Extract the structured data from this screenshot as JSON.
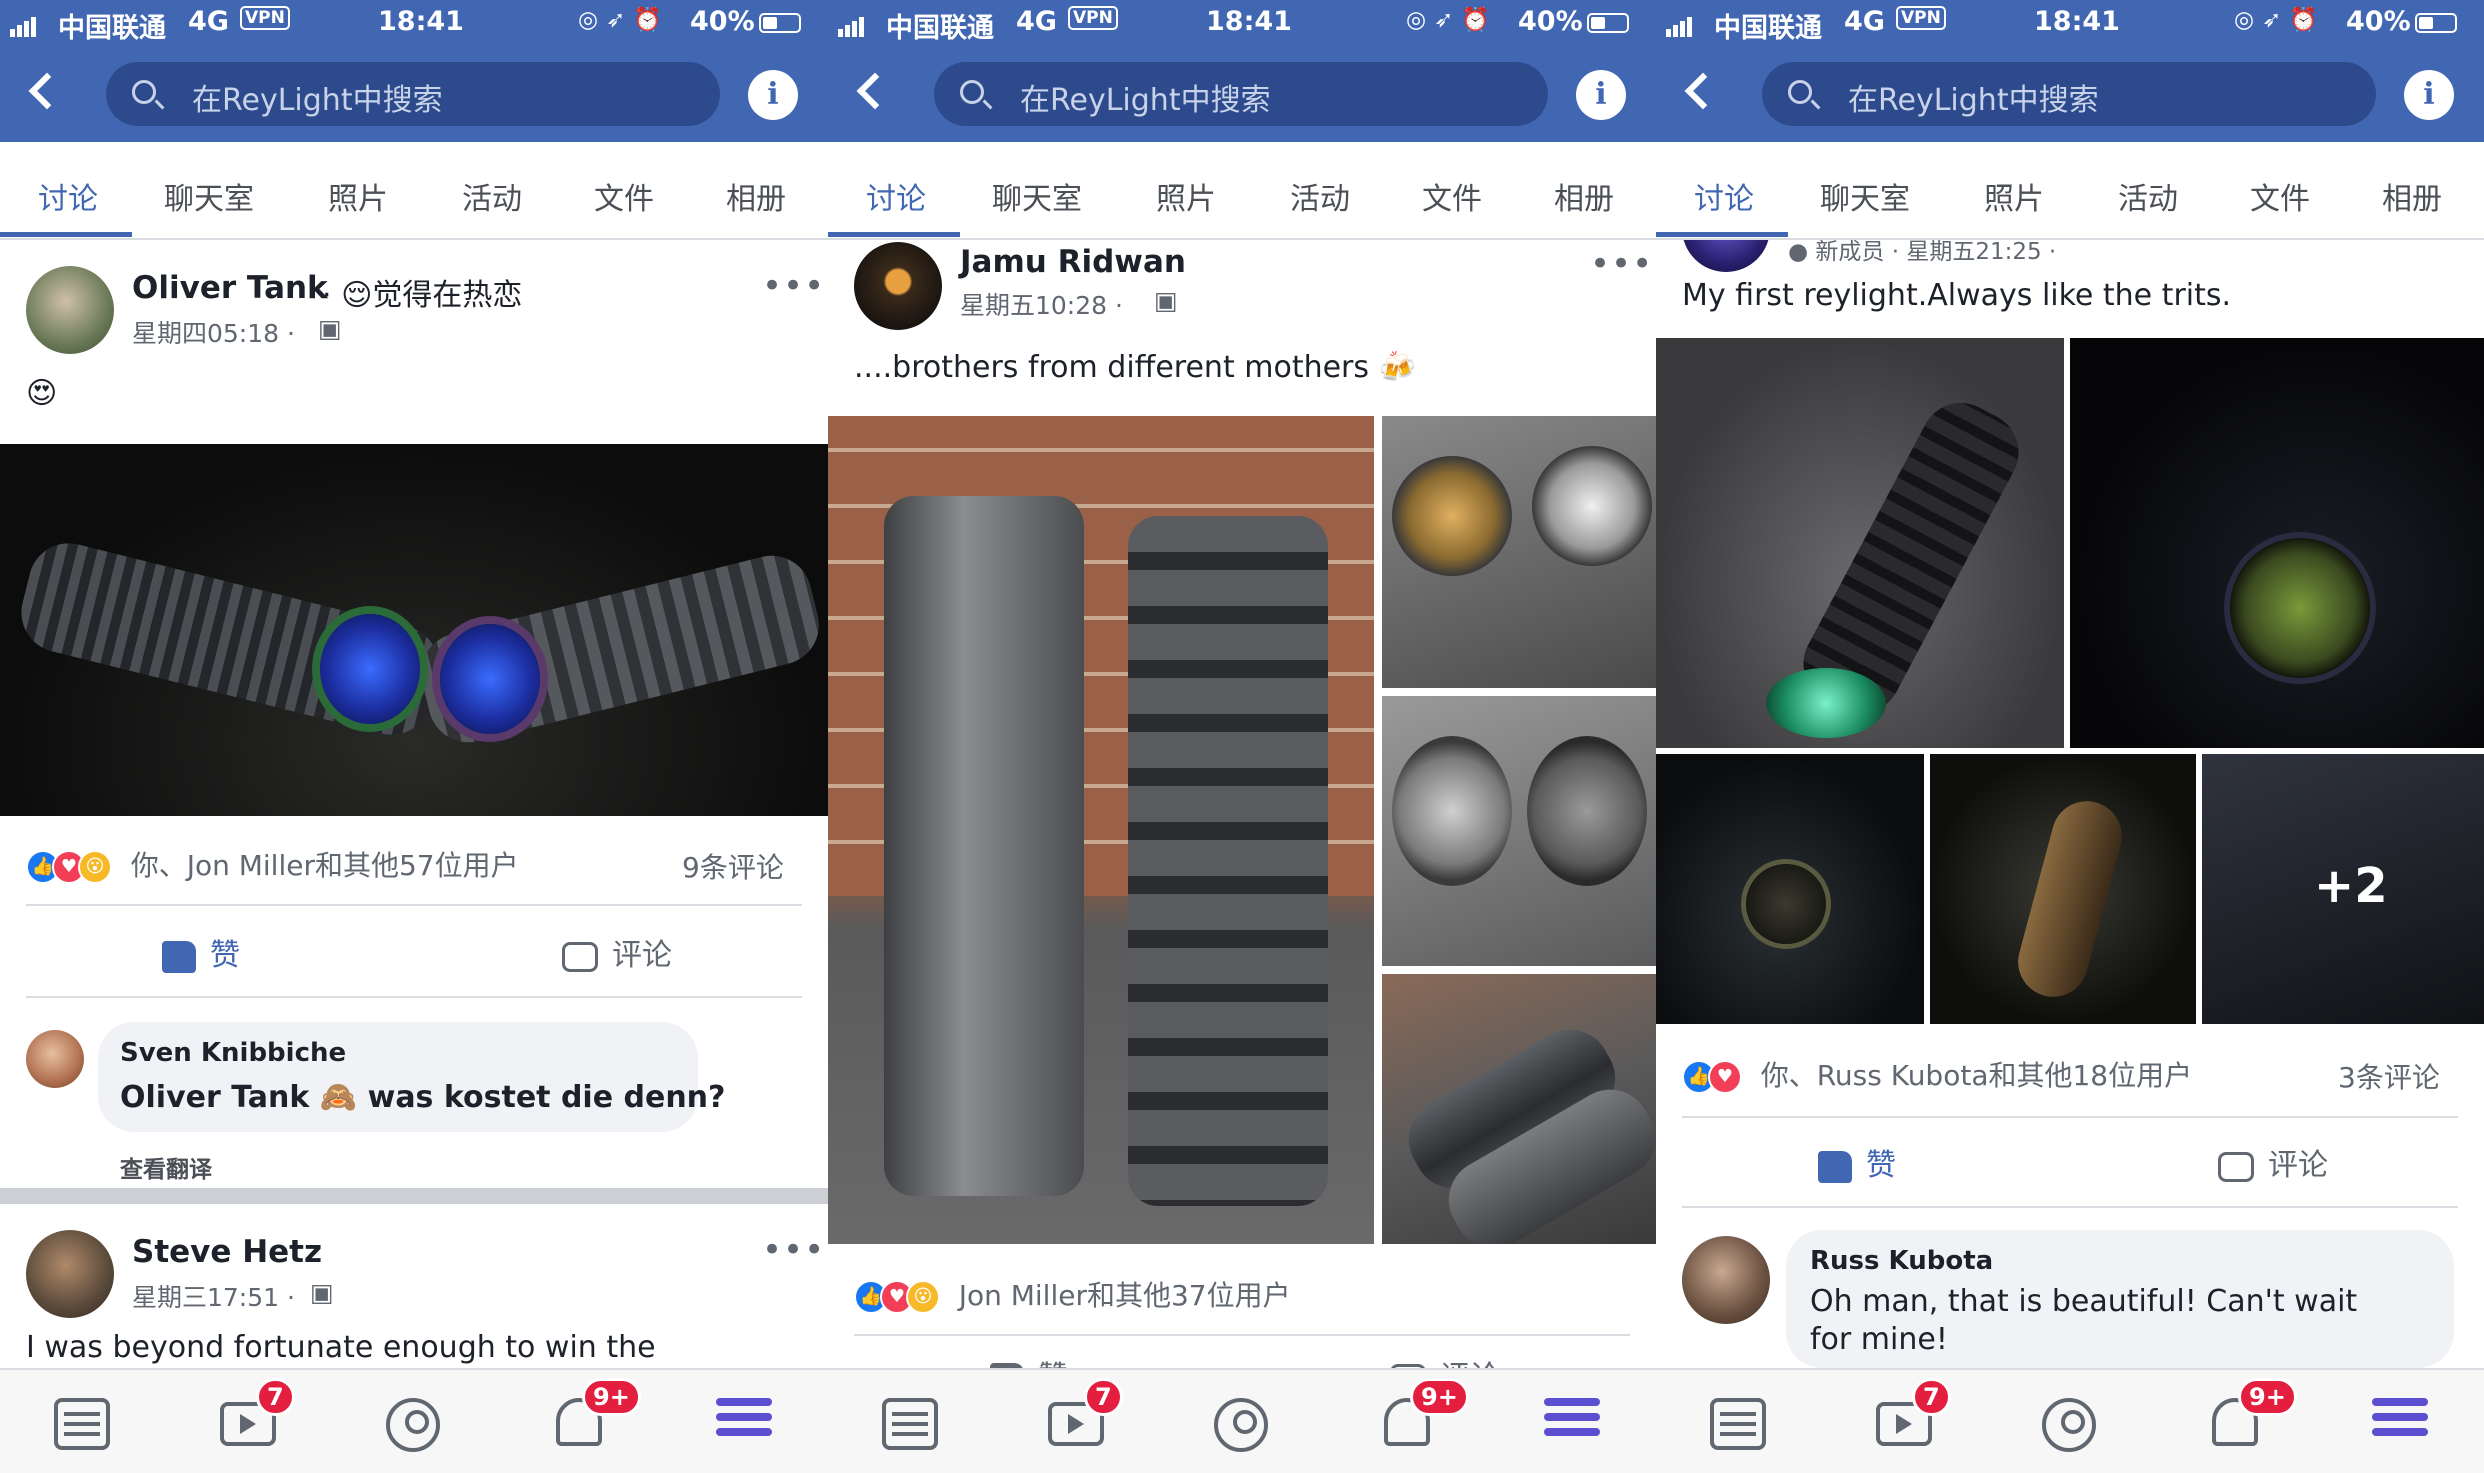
{
  "status_bar": {
    "carrier": "中国联通",
    "network": "4G",
    "vpn": "VPN",
    "time": "18:41",
    "battery": "40%"
  },
  "header": {
    "search_placeholder": "在ReyLight中搜索",
    "info_icon": "i"
  },
  "tabs": [
    "讨论",
    "聊天室",
    "照片",
    "活动",
    "文件",
    "相册"
  ],
  "bottom_nav": {
    "video_badge": "7",
    "notif_badge": "9+"
  },
  "screen1": {
    "post": {
      "author": "Oliver Tank",
      "feeling": "· 😌觉得在热恋",
      "time": "星期四05:18 ·",
      "emoji": "😍",
      "reactions": "你、Jon Miller和其他57位用户",
      "comments": "9条评论",
      "like": "赞",
      "comment": "评论"
    },
    "comment": {
      "author": "Sven Knibbiche",
      "text": "Oliver Tank 🙈 was kostet die denn?",
      "translate": "查看翻译"
    },
    "post2": {
      "author": "Steve Hetz",
      "time": "星期三17:51 ·",
      "text": "I was beyond fortunate enough to win the"
    }
  },
  "screen2": {
    "post": {
      "author": "Jamu Ridwan",
      "time": "星期五10:28 ·",
      "text": "....brothers from different mothers 🍻",
      "reactions": "Jon Miller和其他37位用户",
      "like": "赞",
      "comment": "评论"
    }
  },
  "screen3": {
    "post": {
      "header_partial": "● 新成员 · 星期五21:25 ·",
      "text": "My first reylight.Always like the trits.",
      "more_photos": "+2",
      "reactions": "你、Russ Kubota和其他18位用户",
      "comments": "3条评论",
      "like": "赞",
      "comment": "评论"
    },
    "comment": {
      "author": "Russ Kubota",
      "text_line1": "Oh man,  that is beautiful! Can't wait",
      "text_line2": "for mine!"
    }
  }
}
